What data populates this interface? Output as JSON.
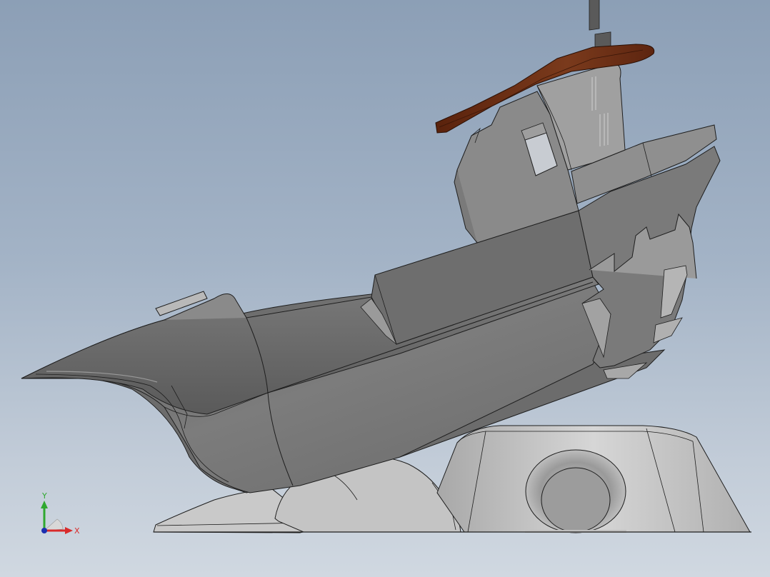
{
  "viewport": {
    "background_top": "#8c9fb6",
    "background_bottom": "#d0d8e1"
  },
  "model": {
    "body_color": "#7a7a7a",
    "roof_color": "#6b2e14",
    "base_color": "#c8c8c8",
    "edge_color": "#1e1e1e"
  },
  "triad": {
    "y_label": "Y",
    "x_label": "X",
    "y_color": "#2fa82f",
    "x_color": "#d92b2b",
    "z_color": "#1c2fb0"
  }
}
